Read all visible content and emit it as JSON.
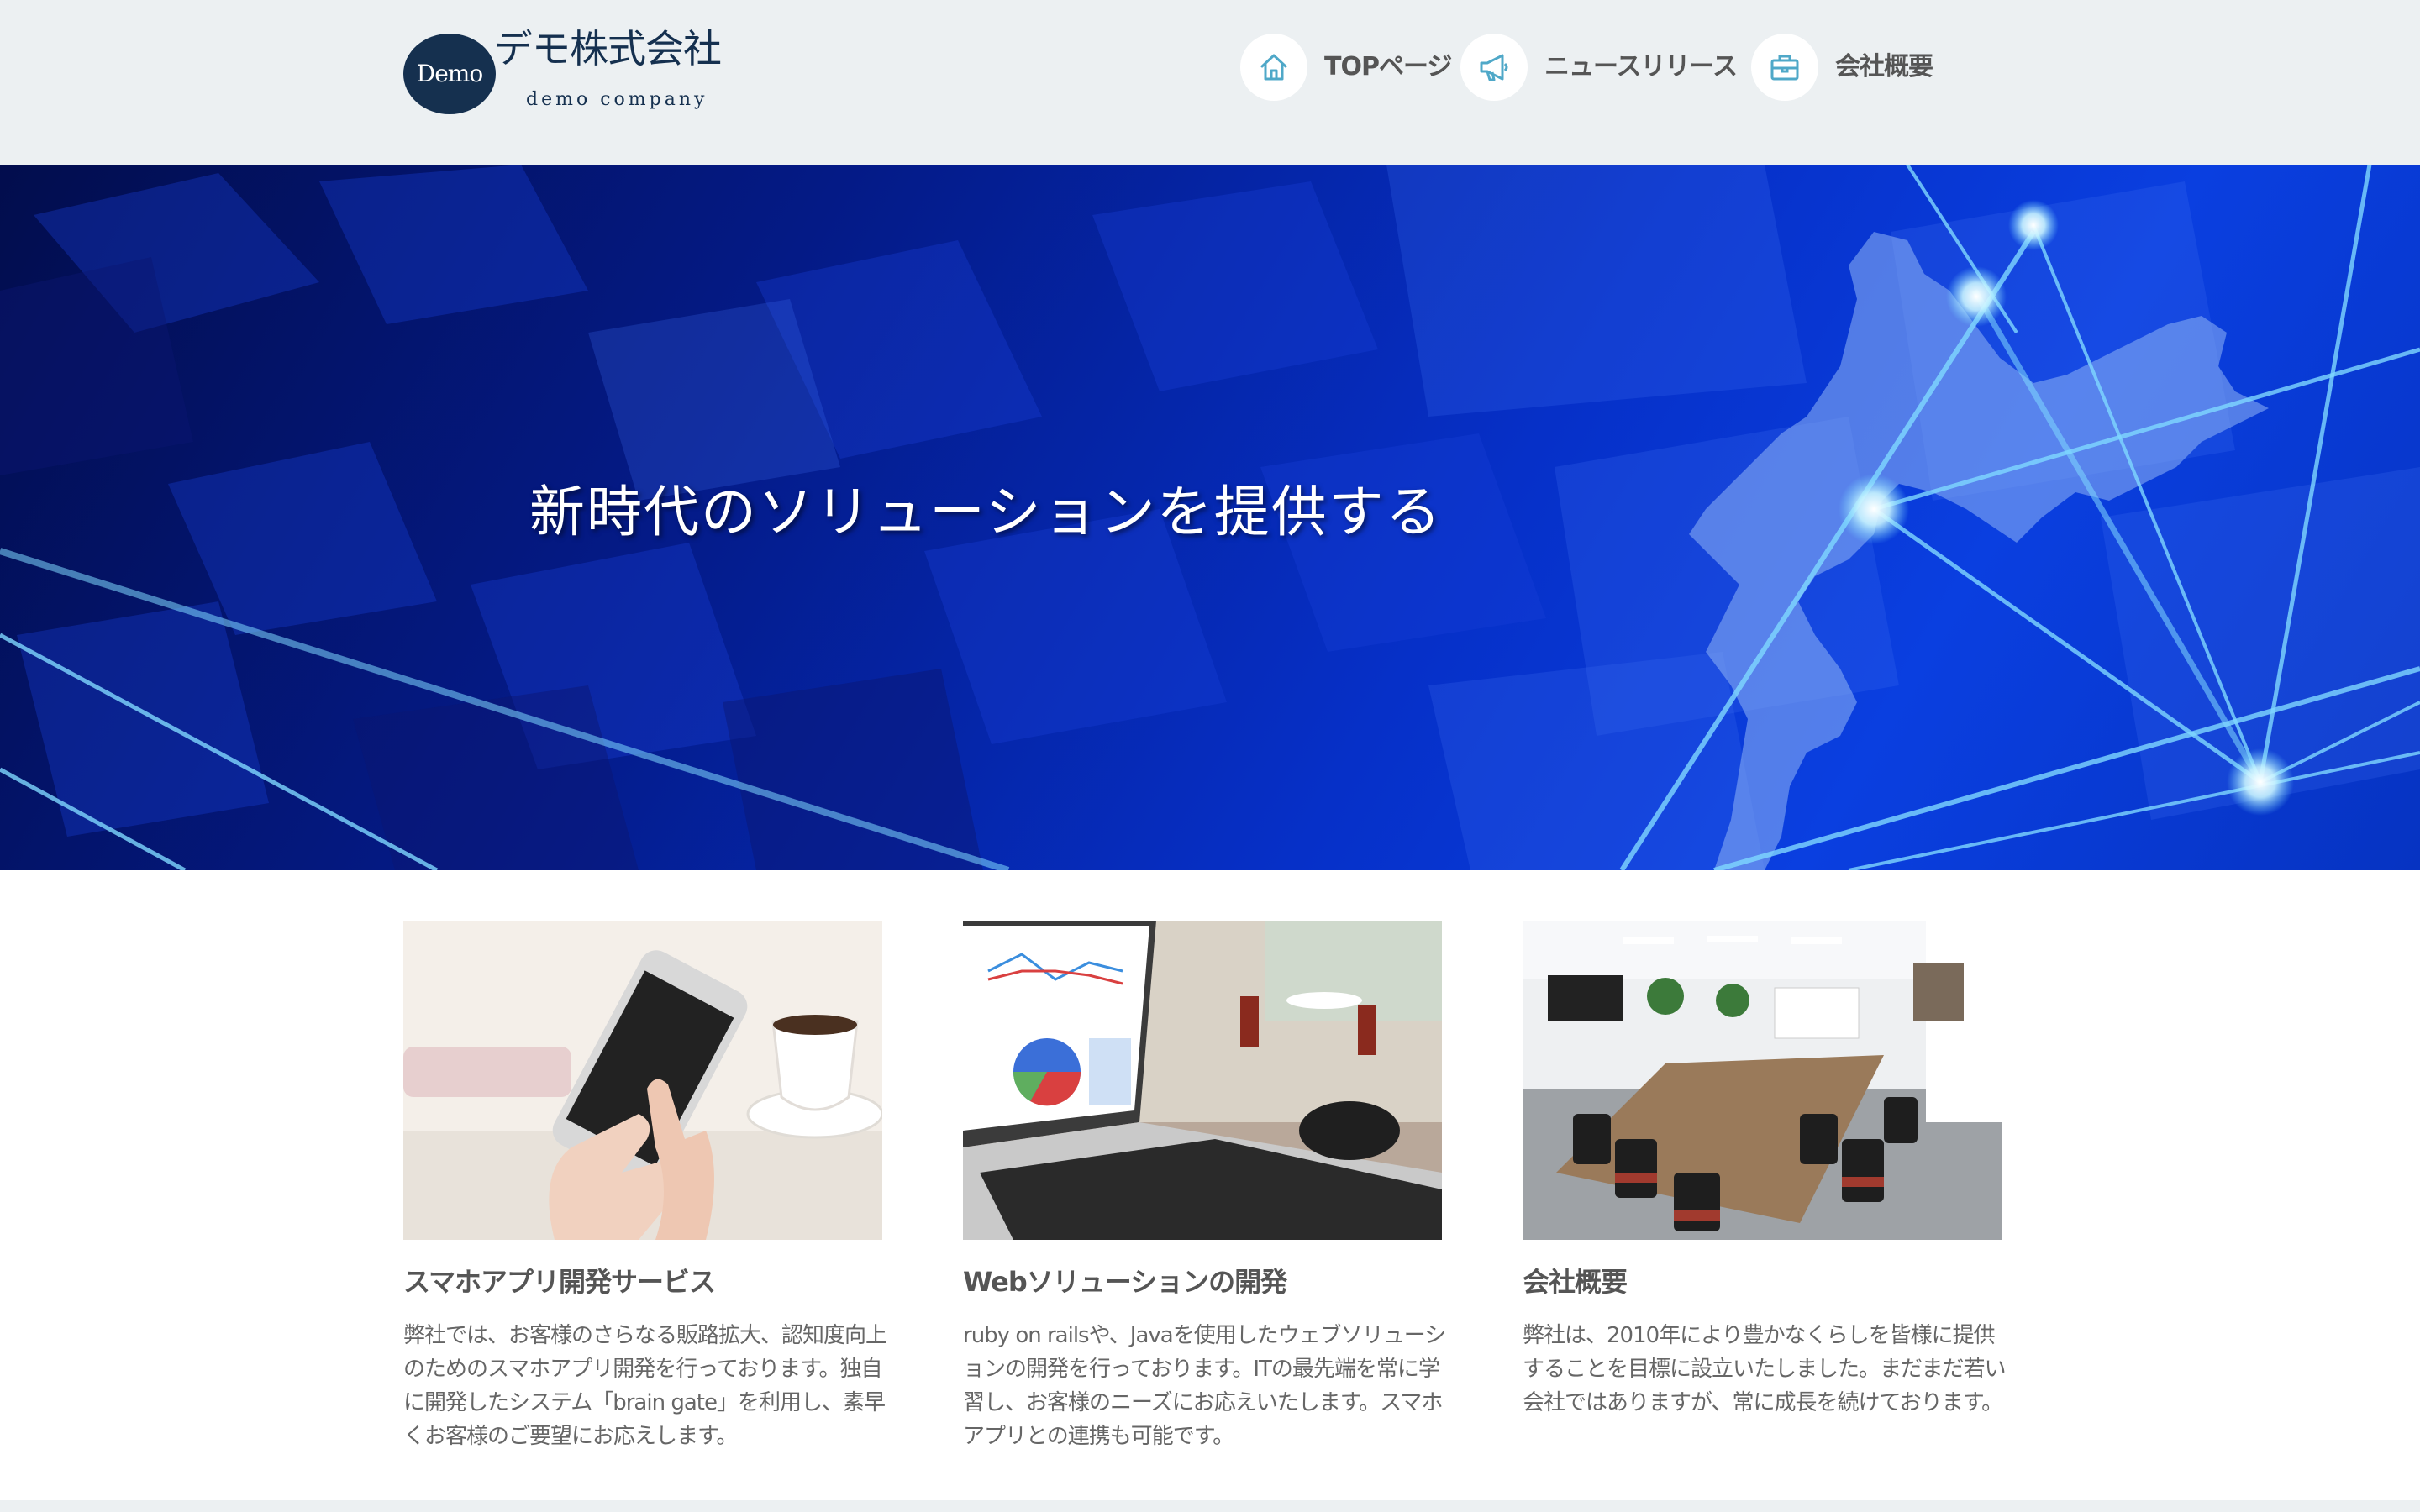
{
  "header": {
    "logo": {
      "mark_text": "Demo",
      "name_jp": "デモ株式会社",
      "name_en": "demo company"
    },
    "nav": [
      {
        "label": "TOPページ",
        "icon": "home-icon"
      },
      {
        "label": "ニュースリリース",
        "icon": "megaphone-icon"
      },
      {
        "label": "会社概要",
        "icon": "briefcase-icon"
      }
    ],
    "icon_color": "#4fa8c8"
  },
  "hero": {
    "title": "新時代のソリューションを提供する"
  },
  "cards": [
    {
      "title": "スマホアプリ開発サービス",
      "text": "弊社では、お客様のさらなる販路拡大、認知度向上のためのスマホアプリ開発を行っております。独自に開発したシステム「brain gate」を利用し、素早くお客様のご要望にお応えします。"
    },
    {
      "title": "Webソリューションの開発",
      "text": "ruby on railsや、Javaを使用したウェブソリューションの開発を行っております。ITの最先端を常に学習し、お客様のニーズにお応えいたします。スマホアプリとの連携も可能です。"
    },
    {
      "title": "会社概要",
      "text": "弊社は、2010年により豊かなくらしを皆様に提供することを目標に設立いたしました。まだまだ若い会社ではありますが、常に成長を続けております。"
    }
  ]
}
